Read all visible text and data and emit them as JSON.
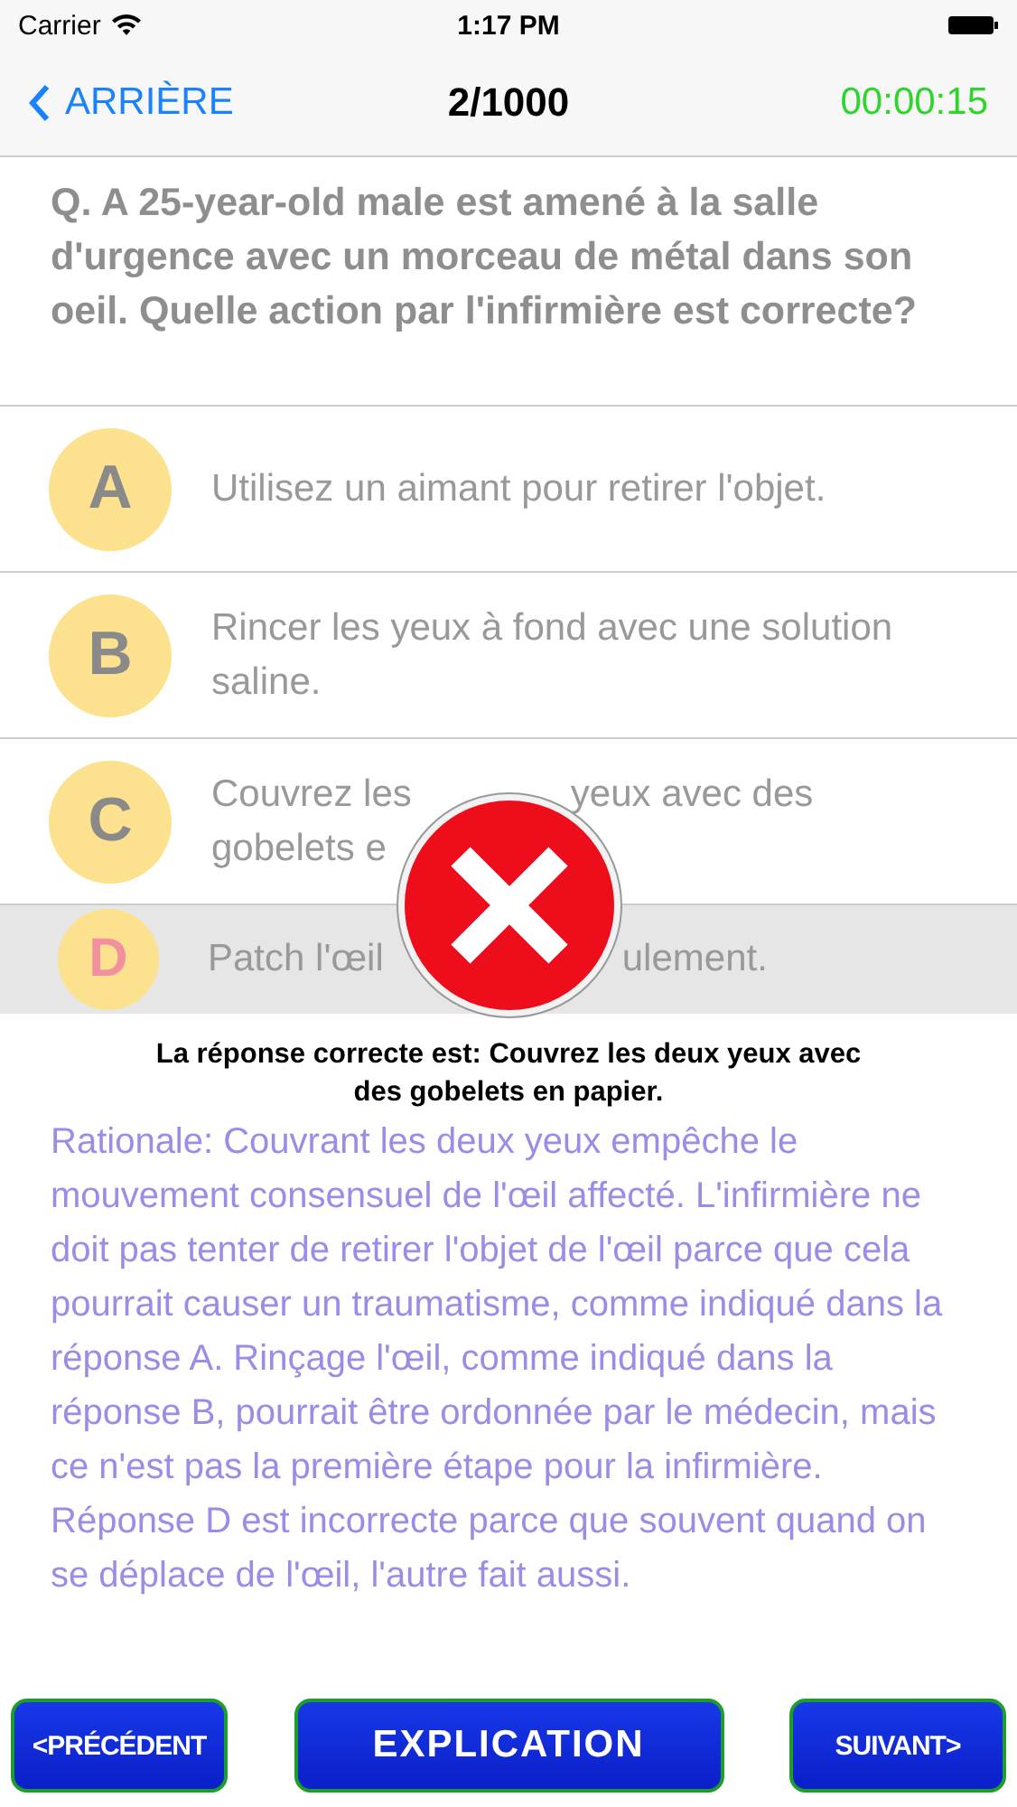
{
  "status_bar": {
    "carrier": "Carrier",
    "time": "1:17 PM"
  },
  "nav": {
    "back": "ARRIÈRE",
    "progress": "2/1000",
    "timer": "00:00:15"
  },
  "question": "Q. A 25-year-old male est amené à la salle d'urgence avec un morceau de métal dans son oeil. Quelle action par l'infirmière est correcte?",
  "options": [
    {
      "letter": "A",
      "kind": "full",
      "text": "Utilisez un aimant pour retirer l'objet.",
      "selected": false
    },
    {
      "letter": "B",
      "kind": "full",
      "text": "Rincer les yeux à fond avec une solution saline.",
      "selected": false
    },
    {
      "letter": "C",
      "kind": "partial",
      "lines": [
        [
          "Couvrez les",
          "yeux avec des"
        ],
        [
          "gobelets e"
        ]
      ],
      "selected": false
    },
    {
      "letter": "D",
      "kind": "partial",
      "lines": [
        [
          "Patch l'œil",
          "ulement."
        ]
      ],
      "selected": true
    }
  ],
  "result": {
    "kind": "wrong"
  },
  "correct_answer": "La réponse correcte est:  Couvrez les deux yeux avec des gobelets en papier.",
  "rationale": "Rationale: Couvrant les deux yeux empêche le mouvement consensuel de l'œil affecté. L'infirmière ne doit pas tenter de retirer l'objet de l'œil parce que cela pourrait causer un traumatisme, comme indiqué dans la réponse A. Rinçage l'œil, comme indiqué dans la réponse B, pourrait être ordonnée par le médecin, mais ce n'est pas la première étape pour la infirmière. Réponse D est incorrecte parce que souvent quand on se déplace de l'œil, l'autre fait aussi.",
  "buttons": {
    "previous": "<PRÉCÉDENT",
    "explanation": "EXPLICATION",
    "next": "SUIVANT>"
  }
}
